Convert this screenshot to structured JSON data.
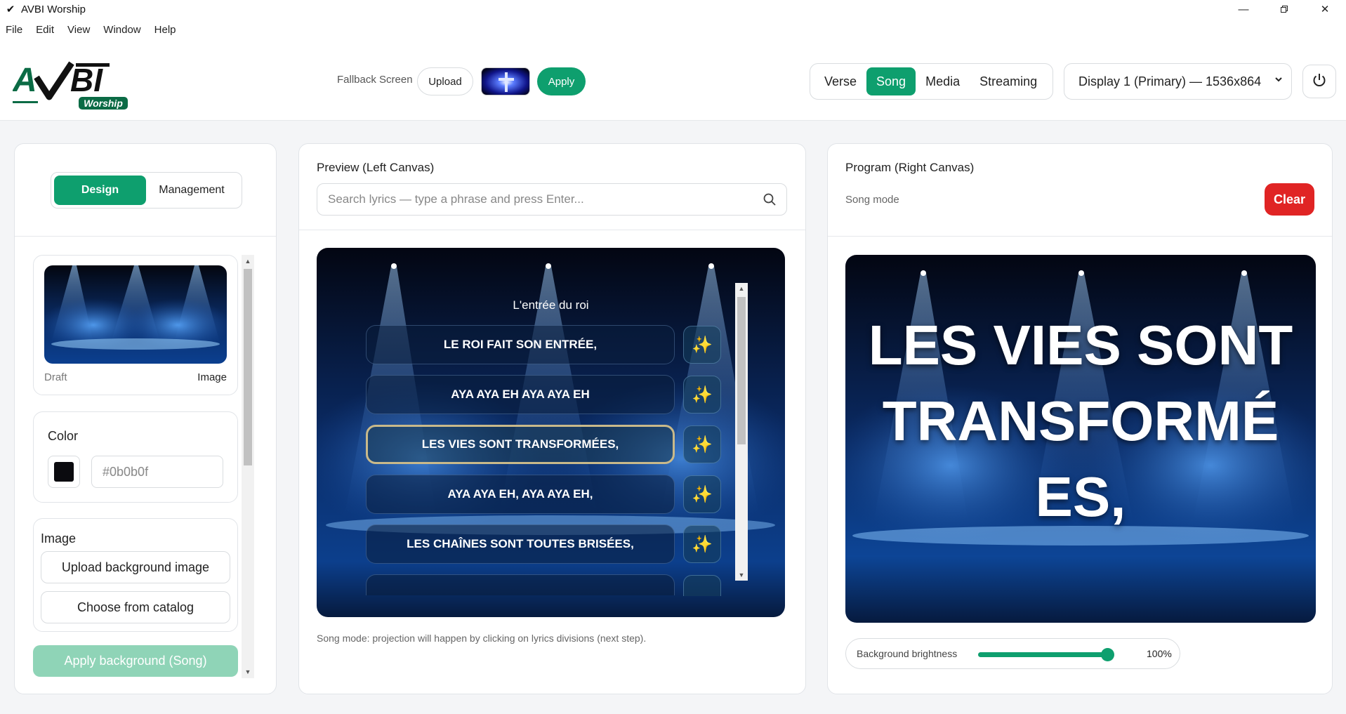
{
  "window": {
    "title": "AVBI Worship",
    "controls": [
      "minimize",
      "maximize",
      "close"
    ]
  },
  "menu": [
    "File",
    "Edit",
    "View",
    "Window",
    "Help"
  ],
  "header": {
    "logo_text": "AVBI",
    "logo_sub": "Worship",
    "fallback_label": "Fallback Screen",
    "upload_label": "Upload",
    "apply_label": "Apply",
    "modes": [
      "Verse",
      "Song",
      "Media",
      "Streaming"
    ],
    "active_mode": "Song",
    "display": "Display 1 (Primary) — 1536x864"
  },
  "left": {
    "tabs": [
      "Design",
      "Management"
    ],
    "active_tab": "Design",
    "draft_label": "Draft",
    "draft_type": "Image",
    "color_label": "Color",
    "color_value": "#0b0b0f",
    "image_label": "Image",
    "upload_bg": "Upload background image",
    "choose_catalog": "Choose from catalog",
    "apply_bg": "Apply background (Song)"
  },
  "middle": {
    "title": "Preview (Left Canvas)",
    "search_placeholder": "Search lyrics — type a phrase and press Enter...",
    "song_title": "L'entrée du roi",
    "lyrics": [
      "LE ROI FAIT SON ENTRÉE,",
      "AYA AYA EH AYA AYA EH",
      "LES VIES SONT TRANSFORMÉES,",
      "AYA AYA EH, AYA AYA EH,",
      "LES CHAÎNES SONT TOUTES BRISÉES,"
    ],
    "active_lyric_index": 2,
    "footer": "Song mode: projection will happen by clicking on lyrics divisions (next step)."
  },
  "right": {
    "title": "Program (Right Canvas)",
    "mode": "Song mode",
    "clear_label": "Clear",
    "program_lines": [
      "LES VIES SONT",
      "TRANSFORMÉ",
      "ES,"
    ],
    "brightness_label": "Background brightness",
    "brightness_value": "100%",
    "brightness_level": 1.0
  },
  "colors": {
    "accent": "#0e9f6e",
    "danger": "#e02424",
    "accent_disabled": "#8fd4b7"
  }
}
